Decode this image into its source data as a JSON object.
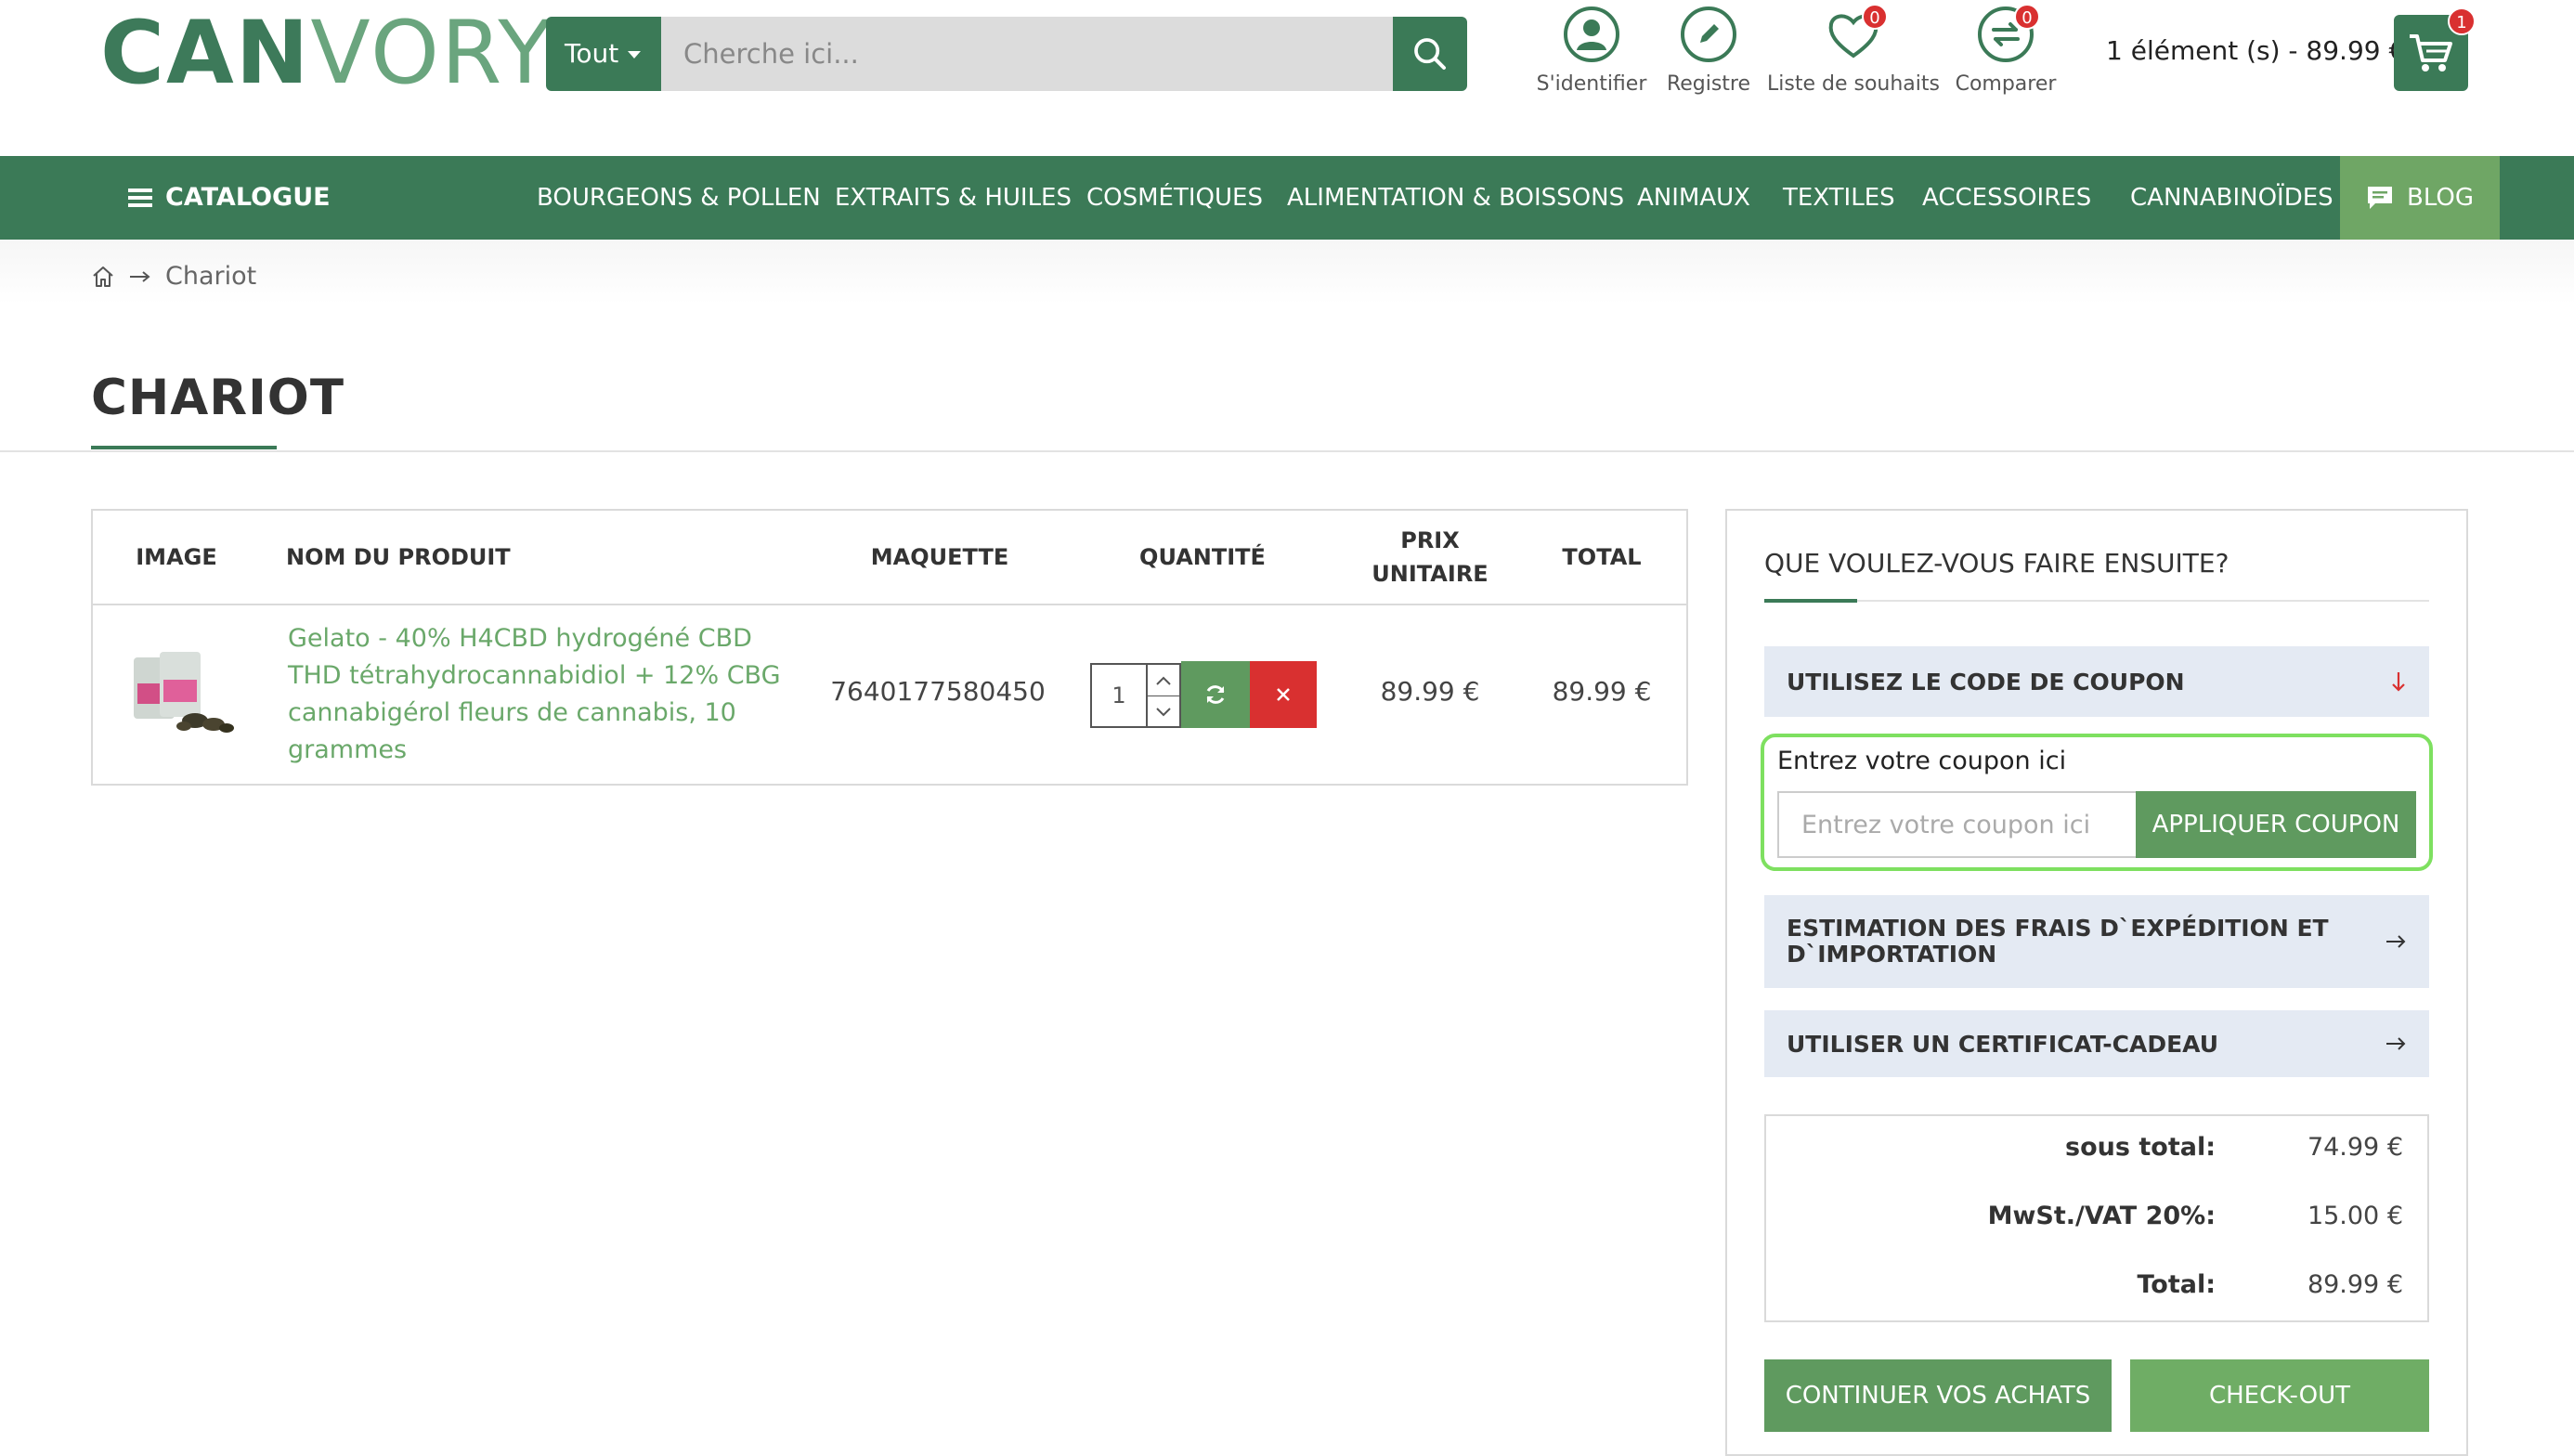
{
  "header": {
    "logo_bold": "CAN",
    "logo_light": "VORY",
    "search_category": "Tout",
    "search_placeholder": "Cherche ici...",
    "account_items": [
      {
        "label": "S'identifier",
        "icon": "user-icon"
      },
      {
        "label": "Registre",
        "icon": "pencil-icon"
      },
      {
        "label": "Liste de souhaits",
        "icon": "heart-icon",
        "badge": "0"
      },
      {
        "label": "Comparer",
        "icon": "compare-icon",
        "badge": "0"
      }
    ],
    "cart_summary": "1 élément (s) - 89.99 €",
    "cart_badge": "1"
  },
  "nav": {
    "catalogue": "CATALOGUE",
    "items": [
      "BOURGEONS & POLLEN",
      "EXTRAITS & HUILES",
      "COSMÉTIQUES",
      "ALIMENTATION & BOISSONS",
      "ANIMAUX",
      "TEXTILES",
      "ACCESSOIRES",
      "CANNABINOÏDES"
    ],
    "blog": "BLOG"
  },
  "breadcrumb": {
    "current": "Chariot"
  },
  "page_title": "CHARIOT",
  "cart_table": {
    "headers": {
      "image": "IMAGE",
      "name": "NOM DU PRODUIT",
      "model": "MAQUETTE",
      "quantity": "QUANTITÉ",
      "unit_price_1": "PRIX",
      "unit_price_2": "UNITAIRE",
      "total": "TOTAL"
    },
    "rows": [
      {
        "name": "Gelato - 40% H4CBD hydrogéné CBD THD tétrahydrocannabidiol + 12% CBG cannabigérol fleurs de cannabis, 10 grammes",
        "model": "7640177580450",
        "quantity": "1",
        "unit_price": "89.99 €",
        "total": "89.99 €"
      }
    ]
  },
  "side_panel": {
    "title": "QUE VOULEZ-VOUS FAIRE ENSUITE?",
    "coupon_header": "UTILISEZ LE CODE DE COUPON",
    "coupon_label": "Entrez votre coupon ici",
    "coupon_placeholder": "Entrez votre coupon ici",
    "coupon_button": "APPLIQUER COUPON",
    "shipping_header_1": "ESTIMATION DES FRAIS D`EXPÉDITION ET",
    "shipping_header_2": "D`IMPORTATION",
    "gift_header": "UTILISER UN CERTIFICAT-CADEAU",
    "totals": [
      {
        "label": "sous total:",
        "value": "74.99 €"
      },
      {
        "label": "MwSt./VAT 20%:",
        "value": "15.00 €"
      },
      {
        "label": "Total:",
        "value": "89.99 €"
      }
    ],
    "continue_button": "CONTINUER VOS ACHATS",
    "checkout_button": "CHECK-OUT"
  },
  "colors": {
    "brand_green": "#3b7a57",
    "button_green": "#5f9a5f",
    "link_green": "#6aa86a",
    "danger": "#d93030",
    "highlight": "#7ee060"
  }
}
